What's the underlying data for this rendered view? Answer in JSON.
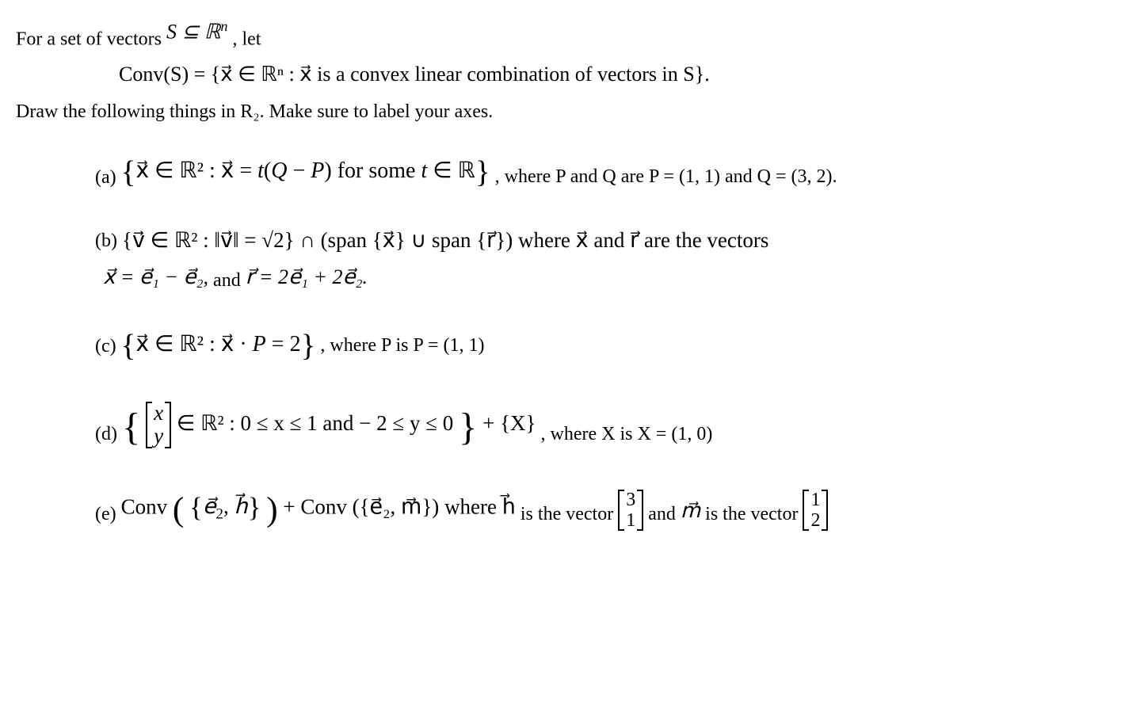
{
  "intro": {
    "prefix": "For a set of vectors ",
    "set_expr": "S ⊆ ℝ",
    "set_sup": "n",
    "suffix": ", let"
  },
  "conv_def": {
    "lhs": "Conv(S) = ",
    "open": "{",
    "x": "x⃗",
    "in": " ∈ ℝ",
    "sup": "n",
    "colon": " : ",
    "body": "x⃗ is a convex linear combination of vectors in  S",
    "close": "}.",
    "full": "Conv(S) = {x⃗ ∈ ℝⁿ : x⃗ is a convex linear combination of vectors in  S}."
  },
  "draw_line": "Draw the following things in R₂. Make sure to label your axes.",
  "items": {
    "a": {
      "label": "(a)",
      "set": "{x⃗ ∈ ℝ² : x⃗ = t(Q − P) for some t ∈ ℝ}",
      "tail": " , where P and Q are P = (1, 1) and Q = (3, 2)."
    },
    "b": {
      "label": "(b)",
      "line1": "{v⃗ ∈ ℝ² : ‖v⃗‖ = √2} ∩ (span {x⃗} ∪ span {r⃗}) where x⃗ and r⃗ are the vectors",
      "line2_pre": "x⃗ = e⃗₁ − e⃗₂,",
      "line2_and": " and ",
      "line2_post": "r⃗ = 2e⃗₁ + 2e⃗₂."
    },
    "c": {
      "label": "(c)",
      "set": "{x⃗ ∈ ℝ² : x⃗ · P = 2}",
      "tail": " , where P is P = (1, 1)"
    },
    "d": {
      "label": "(d)",
      "pre_brace": "{",
      "mat_top": "x",
      "mat_bot": "y",
      "mid": " ∈ ℝ² : 0 ≤ x ≤ 1 and  − 2 ≤ y ≤ 0",
      "post_brace": "}",
      "plus": " + {X}",
      "tail": " , where X is X = (1, 0)"
    },
    "e": {
      "label": "(e)",
      "conv1_pre": "Conv",
      "conv1_open": "(",
      "conv1_set": "{e⃗₂, h⃗}",
      "conv1_close": ")",
      "plus": " + ",
      "conv2": "Conv ({e⃗₂, m⃗})",
      "where": " where h⃗ ",
      "is1_pre": "is the vector ",
      "h_top": "3",
      "h_bot": "1",
      "and": " and  ",
      "m": "m⃗",
      "is2_pre": " is the vector ",
      "m_top": "1",
      "m_bot": "2"
    }
  }
}
